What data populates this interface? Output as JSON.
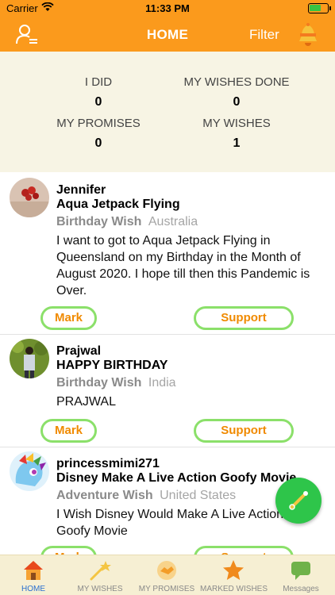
{
  "status_bar": {
    "carrier": "Carrier",
    "time": "11:33 PM"
  },
  "header": {
    "title": "HOME",
    "filter_label": "Filter"
  },
  "stats": {
    "i_did": {
      "label": "I DID",
      "value": "0"
    },
    "my_wishes_done": {
      "label": "MY WISHES DONE",
      "value": "0"
    },
    "my_promises": {
      "label": "MY PROMISES",
      "value": "0"
    },
    "my_wishes": {
      "label": "MY WISHES",
      "value": "1"
    }
  },
  "wishes": [
    {
      "user": "Jennifer",
      "title": "Aqua Jetpack Flying",
      "category": "Birthday Wish",
      "location": "Australia",
      "description": "I want to got to Aqua Jetpack Flying in Queensland on my Birthday in the Month of August 2020. I hope till then this Pandemic is Over.",
      "mark_label": "Mark",
      "support_label": "Support"
    },
    {
      "user": "Prajwal",
      "title": "HAPPY BIRTHDAY",
      "category": "Birthday Wish",
      "location": "India",
      "description": "PRAJWAL",
      "mark_label": "Mark",
      "support_label": "Support"
    },
    {
      "user": "princessmimi271",
      "title": "Disney Make A Live Action Goofy Movie",
      "category": "Adventure Wish",
      "location": "United States",
      "description": "I Wish Disney Would Make A Live Action Goofy Movie",
      "mark_label": "Mark",
      "support_label": "Support"
    }
  ],
  "tabs": [
    {
      "label": "HOME",
      "icon": "house-icon",
      "active": true
    },
    {
      "label": "MY WISHES",
      "icon": "shooting-star-icon",
      "active": false
    },
    {
      "label": "MY PROMISES",
      "icon": "handshake-icon",
      "active": false
    },
    {
      "label": "MARKED WISHES",
      "icon": "star-icon",
      "active": false
    },
    {
      "label": "Messages",
      "icon": "chat-bubble-icon",
      "active": false
    }
  ],
  "colors": {
    "brand_orange": "#fb9a1c",
    "stats_bg": "#f7f4e4",
    "button_border": "#8be06a",
    "button_text": "#f08a00",
    "fab_green": "#2ec54a",
    "tab_active": "#2a6fd0"
  }
}
